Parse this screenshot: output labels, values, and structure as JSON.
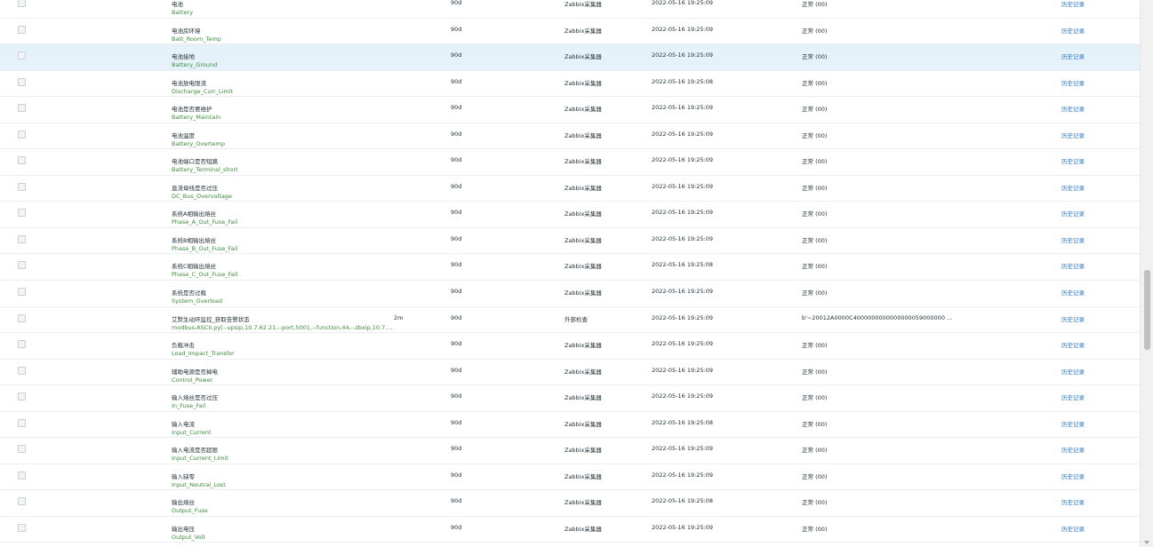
{
  "rows": [
    {
      "name": "电池",
      "key": "Battery",
      "interval": "",
      "history": "90d",
      "type": "Zabbix采集器",
      "time": "2022-05-16 19:25:09",
      "value": "正常 (00)",
      "link": "历史记录"
    },
    {
      "name": "电池房环境",
      "key": "Batt_Room_Temp",
      "interval": "",
      "history": "90d",
      "type": "Zabbix采集器",
      "time": "2022-05-16 19:25:09",
      "value": "正常 (00)",
      "link": "历史记录"
    },
    {
      "name": "电池接地",
      "key": "Battery_Ground",
      "interval": "",
      "history": "90d",
      "type": "Zabbix采集器",
      "time": "2022-05-16 19:25:09",
      "value": "正常 (00)",
      "link": "历史记录"
    },
    {
      "name": "电池放电限流",
      "key": "Discharge_Curr_Limit",
      "interval": "",
      "history": "90d",
      "type": "Zabbix采集器",
      "time": "2022-05-16 19:25:08",
      "value": "正常 (00)",
      "link": "历史记录"
    },
    {
      "name": "电池是否要维护",
      "key": "Battery_Maintain",
      "interval": "",
      "history": "90d",
      "type": "Zabbix采集器",
      "time": "2022-05-16 19:25:09",
      "value": "正常 (00)",
      "link": "历史记录"
    },
    {
      "name": "电池温度",
      "key": "Battery_Overtemp",
      "interval": "",
      "history": "90d",
      "type": "Zabbix采集器",
      "time": "2022-05-16 19:25:09",
      "value": "正常 (00)",
      "link": "历史记录"
    },
    {
      "name": "电池端口是否短路",
      "key": "Battery_Terminal_short",
      "interval": "",
      "history": "90d",
      "type": "Zabbix采集器",
      "time": "2022-05-16 19:25:09",
      "value": "正常 (00)",
      "link": "历史记录"
    },
    {
      "name": "直流母线是否过压",
      "key": "DC_Bus_Overvoltage",
      "interval": "",
      "history": "90d",
      "type": "Zabbix采集器",
      "time": "2022-05-16 19:25:09",
      "value": "正常 (00)",
      "link": "历史记录"
    },
    {
      "name": "系统A相输出熔丝",
      "key": "Phase_A_Out_Fuse_Fail",
      "interval": "",
      "history": "90d",
      "type": "Zabbix采集器",
      "time": "2022-05-16 19:25:09",
      "value": "正常 (00)",
      "link": "历史记录"
    },
    {
      "name": "系统B相输出熔丝",
      "key": "Phase_B_Out_Fuse_Fail",
      "interval": "",
      "history": "90d",
      "type": "Zabbix采集器",
      "time": "2022-05-16 19:25:09",
      "value": "正常 (00)",
      "link": "历史记录"
    },
    {
      "name": "系统C相输出熔丝",
      "key": "Phase_C_Out_Fuse_Fail",
      "interval": "",
      "history": "90d",
      "type": "Zabbix采集器",
      "time": "2022-05-16 19:25:08",
      "value": "正常 (00)",
      "link": "历史记录"
    },
    {
      "name": "系统是否过载",
      "key": "System_Overload",
      "interval": "",
      "history": "90d",
      "type": "Zabbix采集器",
      "time": "2022-05-16 19:25:09",
      "value": "正常 (00)",
      "link": "历史记录"
    },
    {
      "name": "艾默生动环监控_获取告警状态",
      "key": "modbus-ASCII.py[--upsip,10.7.62.21,--port,5001,--function,44,--zbxip,10.7....",
      "interval": "2m",
      "history": "90d",
      "type": "外部检查",
      "time": "2022-05-16 19:25:09",
      "value": "b'~20012A0000C4000000000000000059000000 ...",
      "link": "历史记录"
    },
    {
      "name": "负载冲击",
      "key": "Load_Impact_Transfer",
      "interval": "",
      "history": "90d",
      "type": "Zabbix采集器",
      "time": "2022-05-16 19:25:09",
      "value": "正常 (00)",
      "link": "历史记录"
    },
    {
      "name": "辅助电源是否掉电",
      "key": "Control_Power",
      "interval": "",
      "history": "90d",
      "type": "Zabbix采集器",
      "time": "2022-05-16 19:25:09",
      "value": "正常 (00)",
      "link": "历史记录"
    },
    {
      "name": "输入熔丝是否过压",
      "key": "In_Fuse_Fail",
      "interval": "",
      "history": "90d",
      "type": "Zabbix采集器",
      "time": "2022-05-16 19:25:09",
      "value": "正常 (00)",
      "link": "历史记录"
    },
    {
      "name": "输入电流",
      "key": "Input_Current",
      "interval": "",
      "history": "90d",
      "type": "Zabbix采集器",
      "time": "2022-05-16 19:25:08",
      "value": "正常 (00)",
      "link": "历史记录"
    },
    {
      "name": "输入电流是否超限",
      "key": "Input_Current_Limit",
      "interval": "",
      "history": "90d",
      "type": "Zabbix采集器",
      "time": "2022-05-16 19:25:09",
      "value": "正常 (00)",
      "link": "历史记录"
    },
    {
      "name": "输入缺零",
      "key": "Input_Neutral_Lost",
      "interval": "",
      "history": "90d",
      "type": "Zabbix采集器",
      "time": "2022-05-16 19:25:09",
      "value": "正常 (00)",
      "link": "历史记录"
    },
    {
      "name": "输出熔丝",
      "key": "Output_Fuse",
      "interval": "",
      "history": "90d",
      "type": "Zabbix采集器",
      "time": "2022-05-16 19:25:08",
      "value": "正常 (00)",
      "link": "历史记录"
    },
    {
      "name": "输出电压",
      "key": "Output_Volt",
      "interval": "",
      "history": "90d",
      "type": "Zabbix采集器",
      "time": "2022-05-16 19:25:09",
      "value": "正常 (00)",
      "link": "历史记录"
    }
  ],
  "highlight_row": 2
}
